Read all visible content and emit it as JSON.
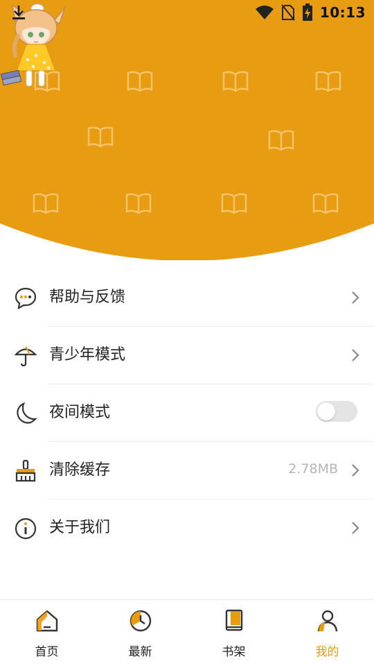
{
  "status_bar": {
    "time": "10:13",
    "icons": [
      "download-icon",
      "wifi-icon",
      "no-sim-icon",
      "battery-charging-icon"
    ]
  },
  "colors": {
    "brand": "#E89C12",
    "active_tab": "#E89C12",
    "toggle_off": "#E4E4E4",
    "muted_text": "#B5B5B5"
  },
  "header": {
    "pattern_icon": "open-book-icon",
    "avatar_icon": "cat-girl-avatar"
  },
  "menu": {
    "items": [
      {
        "label": "帮助与反馈",
        "icon": "chat-bubble-icon",
        "has_chevron": true
      },
      {
        "label": "青少年模式",
        "icon": "umbrella-icon",
        "has_chevron": true
      },
      {
        "label": "夜间模式",
        "icon": "moon-icon",
        "toggle": false
      },
      {
        "label": "清除缓存",
        "icon": "broom-icon",
        "value": "2.78MB",
        "has_chevron": true
      },
      {
        "label": "关于我们",
        "icon": "info-icon",
        "has_chevron": true
      }
    ]
  },
  "bottom_nav": {
    "tabs": [
      {
        "label": "首页",
        "icon": "home-icon",
        "active": false
      },
      {
        "label": "最新",
        "icon": "clock-icon",
        "active": false
      },
      {
        "label": "书架",
        "icon": "bookshelf-icon",
        "active": false
      },
      {
        "label": "我的",
        "icon": "profile-icon",
        "active": true
      }
    ]
  }
}
